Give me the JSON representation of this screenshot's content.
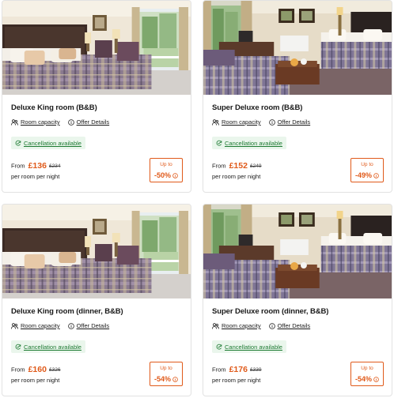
{
  "labels": {
    "room_capacity": "Room capacity",
    "offer_details": "Offer Details",
    "cancellation": "Cancellation available",
    "from": "From",
    "per_night": "per room per night",
    "up_to": "Up to"
  },
  "colors": {
    "accent": "#e05a1a",
    "cancel_text": "#1d7a32",
    "cancel_bg": "#eaf6ec"
  },
  "rooms": [
    {
      "title": "Deluxe King room (B&B)",
      "price": "£136",
      "old_price": "£234",
      "discount": "-50%",
      "image": "deluxe-king-bedroom-photo"
    },
    {
      "title": "Super Deluxe room (B&B)",
      "price": "£152",
      "old_price": "£249",
      "discount": "-49%",
      "image": "super-deluxe-bedroom-photo"
    },
    {
      "title": "Deluxe King room (dinner, B&B)",
      "price": "£160",
      "old_price": "£326",
      "discount": "-54%",
      "image": "deluxe-king-bedroom-photo"
    },
    {
      "title": "Super Deluxe room (dinner, B&B)",
      "price": "£176",
      "old_price": "£339",
      "discount": "-54%",
      "image": "super-deluxe-bedroom-photo"
    }
  ]
}
